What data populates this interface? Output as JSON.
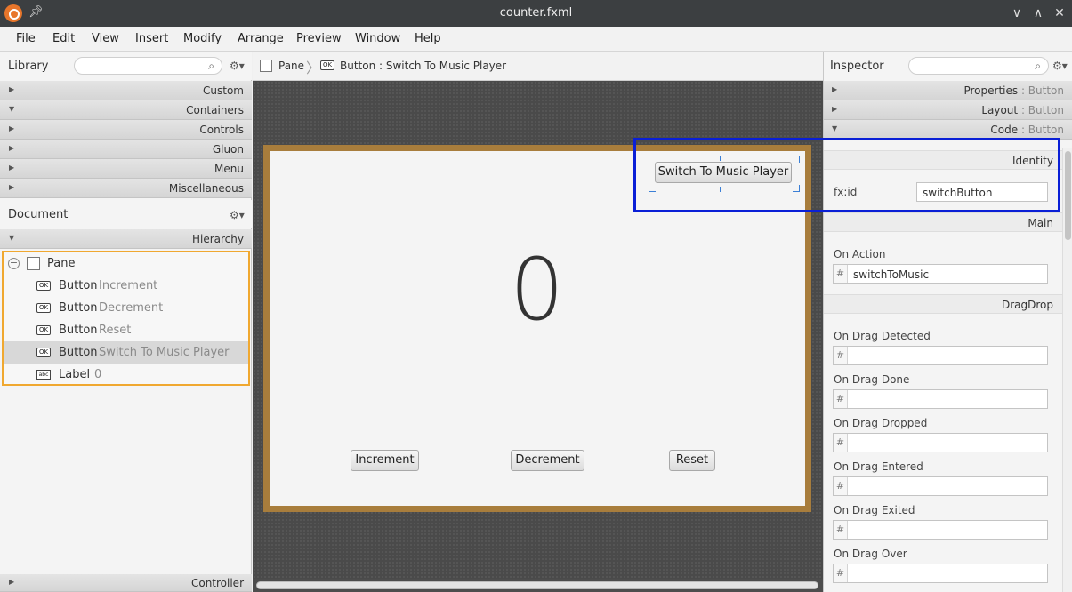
{
  "window": {
    "title": "counter.fxml"
  },
  "menu": [
    "File",
    "Edit",
    "View",
    "Insert",
    "Modify",
    "Arrange",
    "Preview",
    "Window",
    "Help"
  ],
  "library": {
    "title": "Library",
    "categories": [
      {
        "label": "Custom",
        "expanded": false
      },
      {
        "label": "Containers",
        "expanded": true
      },
      {
        "label": "Controls",
        "expanded": false
      },
      {
        "label": "Gluon",
        "expanded": false
      },
      {
        "label": "Menu",
        "expanded": false
      },
      {
        "label": "Miscellaneous",
        "expanded": false
      }
    ]
  },
  "document": {
    "title": "Document",
    "hierarchy_label": "Hierarchy",
    "tree": [
      {
        "type": "Pane",
        "name": ""
      },
      {
        "type": "Button",
        "name": "Increment"
      },
      {
        "type": "Button",
        "name": "Decrement"
      },
      {
        "type": "Button",
        "name": "Reset"
      },
      {
        "type": "Button",
        "name": "Switch To Music Player"
      },
      {
        "type": "Label",
        "name": "0"
      }
    ],
    "controller_label": "Controller"
  },
  "breadcrumb": {
    "root": "Pane",
    "current": "Button : Switch To Music Player",
    "ok_glyph": "OK"
  },
  "canvas": {
    "switch_button": "Switch To Music Player",
    "counter_label": "0",
    "increment": "Increment",
    "decrement": "Decrement",
    "reset": "Reset"
  },
  "inspector": {
    "title": "Inspector",
    "properties": "Properties",
    "layout": "Layout",
    "code": "Code",
    "target": "Button",
    "identity": "Identity",
    "fxid_label": "fx:id",
    "fxid_value": "switchButton",
    "main": "Main",
    "on_action_label": "On Action",
    "on_action_value": "switchToMusic",
    "dragdrop": "DragDrop",
    "drag_fields": [
      "On Drag Detected",
      "On Drag Done",
      "On Drag Dropped",
      "On Drag Entered",
      "On Drag Exited",
      "On Drag Over"
    ],
    "hash": "#"
  },
  "colors": {
    "accent_orange": "#f0a830",
    "highlight_blue": "#0a1fd6",
    "frame_brown": "#a87d3c"
  }
}
